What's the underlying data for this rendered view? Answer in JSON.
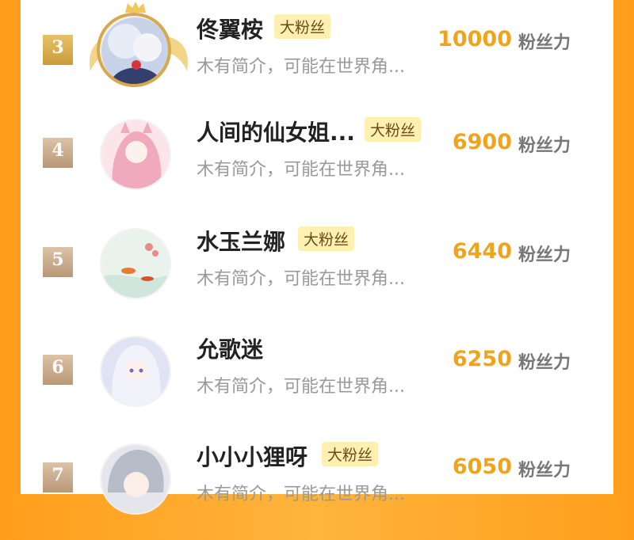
{
  "unit_label": "粉丝力",
  "rows": [
    {
      "rank": "3",
      "name": "佟翼桉",
      "badge": "大粉丝",
      "intro": "木有简介，可能在世界角...",
      "score": "10000"
    },
    {
      "rank": "4",
      "name": "人间的仙女姐...",
      "badge": "大粉丝",
      "intro": "木有简介，可能在世界角...",
      "score": "6900"
    },
    {
      "rank": "5",
      "name": "水玉兰娜",
      "badge": "大粉丝",
      "intro": "木有简介，可能在世界角...",
      "score": "6440"
    },
    {
      "rank": "6",
      "name": "允歌迷",
      "badge": "",
      "intro": "木有简介，可能在世界角...",
      "score": "6250"
    },
    {
      "rank": "7",
      "name": "小小小狸呀",
      "badge": "大粉丝",
      "intro": "木有简介，可能在世界角...",
      "score": "6050"
    }
  ],
  "colors": {
    "accent": "#f0a41c",
    "badge_bg": "#fdf0b0",
    "background": "#ff9e1b"
  }
}
